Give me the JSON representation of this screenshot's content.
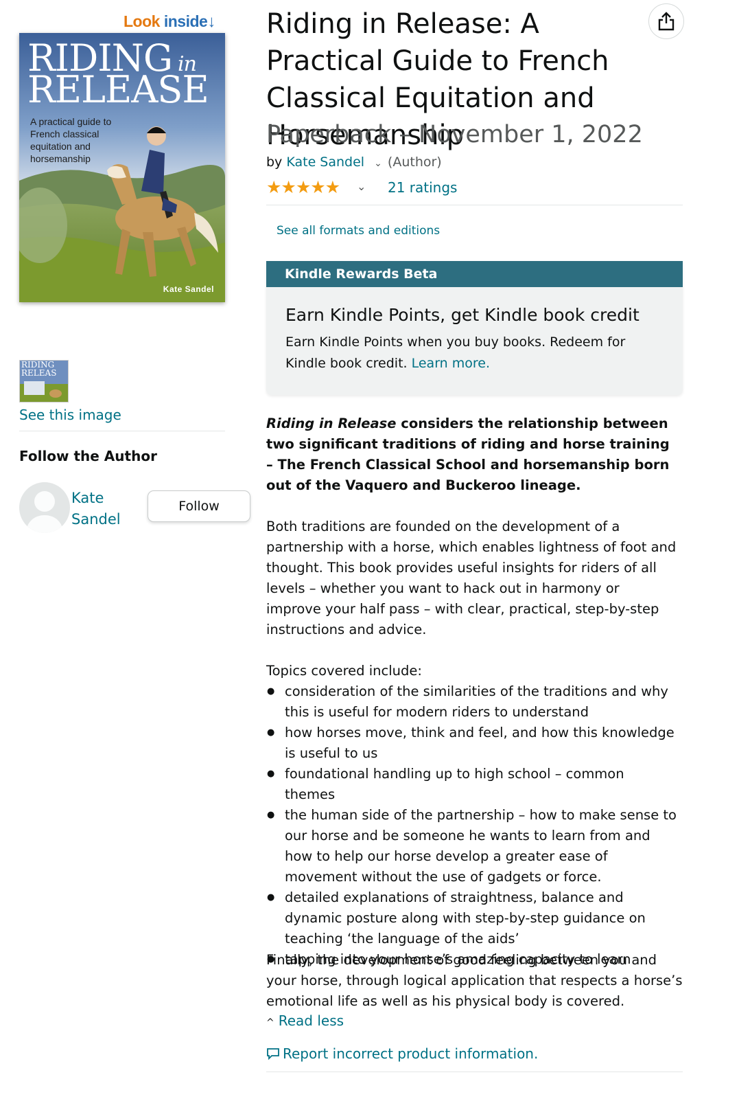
{
  "cover": {
    "look_inside_look": "Look",
    "look_inside_inside": "inside",
    "title_line1": "RIDING",
    "title_in": "in",
    "title_line2": "RELEASE",
    "subtitle": "A practical guide to French classical equitation and horsemanship",
    "author": "Kate Sandel"
  },
  "left": {
    "thumb_text": "RIDING RELEAS",
    "see_image": "See this image",
    "follow_heading": "Follow the Author",
    "author_name": "Kate Sandel",
    "follow_button": "Follow"
  },
  "product": {
    "title": "Riding in Release: A Practical Guide to French Classical Equitation and Horsemanship",
    "format_line": "Paperback – November 1, 2022",
    "by": "by",
    "author": "Kate Sandel",
    "author_role": "(Author)",
    "rating_stars": "★★★★★",
    "rating_value": 5,
    "ratings_count": "21 ratings",
    "see_formats": "See all formats and editions"
  },
  "kindle": {
    "header": "Kindle Rewards Beta",
    "heading": "Earn Kindle Points, get Kindle book credit",
    "body": "Earn Kindle Points when you buy books. Redeem for Kindle book credit.",
    "learn_more": "Learn more."
  },
  "description": {
    "lead_italic": "Riding in Release",
    "lead_rest": " considers the relationship between two significant traditions of riding and horse training – The French Classical School and horsemanship born out of the Vaquero and Buckeroo lineage.",
    "para1": "Both traditions are founded on the development of a partnership with a horse, which enables lightness of foot and thought. This book provides useful insights for riders of all levels – whether you want to hack out in harmony or improve your half pass – with clear, practical, step-by-step instructions and advice.",
    "topics_intro": "Topics covered include:",
    "topics": [
      "consideration of the similarities of the traditions and why this is useful for modern riders to understand",
      "how horses move, think and feel, and how this knowledge is useful to us",
      "foundational handling up to high school – common themes",
      "the human side of the partnership – how to make sense to our horse and be someone he wants to learn from and how to help our horse develop a greater ease of movement without the use of gadgets or force.",
      "detailed explanations of straightness, balance and dynamic posture along with step-by-step guidance on teaching ‘the language of the aids’",
      "tapping into your horse’s amazing capacity to learn"
    ],
    "finally": "Finally, the development of good feeling between you and your horse, through logical application that respects a horse’s emotional life as well as his physical body is covered.",
    "read_less": "Read less",
    "report": "Report incorrect product information."
  },
  "colors": {
    "link": "#007185",
    "star": "#f39c12",
    "kindle_header": "#2d6e80",
    "look_inside_orange": "#e47911"
  }
}
